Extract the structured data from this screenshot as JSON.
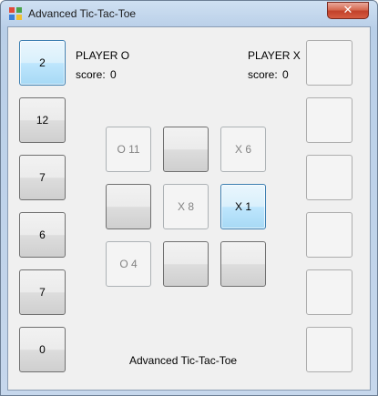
{
  "window": {
    "title": "Advanced Tic-Tac-Toe",
    "close_label": "✕"
  },
  "left_column": [
    {
      "label": "2",
      "state": "hot"
    },
    {
      "label": "12",
      "state": "normal"
    },
    {
      "label": "7",
      "state": "normal"
    },
    {
      "label": "6",
      "state": "normal"
    },
    {
      "label": "7",
      "state": "normal"
    },
    {
      "label": "0",
      "state": "normal"
    }
  ],
  "right_column": [
    "",
    "",
    "",
    "",
    "",
    ""
  ],
  "players": {
    "o": {
      "name": "PLAYER O",
      "score_label": "score:",
      "score": "0"
    },
    "x": {
      "name": "PLAYER X",
      "score_label": "score:",
      "score": "0"
    }
  },
  "board": [
    {
      "label": "O 11",
      "state": "disabled"
    },
    {
      "label": "",
      "state": "normal"
    },
    {
      "label": "X 6",
      "state": "disabled"
    },
    {
      "label": "",
      "state": "normal"
    },
    {
      "label": "X 8",
      "state": "disabled"
    },
    {
      "label": "X 1",
      "state": "hot"
    },
    {
      "label": "O 4",
      "state": "disabled"
    },
    {
      "label": "",
      "state": "normal"
    },
    {
      "label": "",
      "state": "normal"
    }
  ],
  "footer_text": "Advanced Tic-Tac-Toe"
}
